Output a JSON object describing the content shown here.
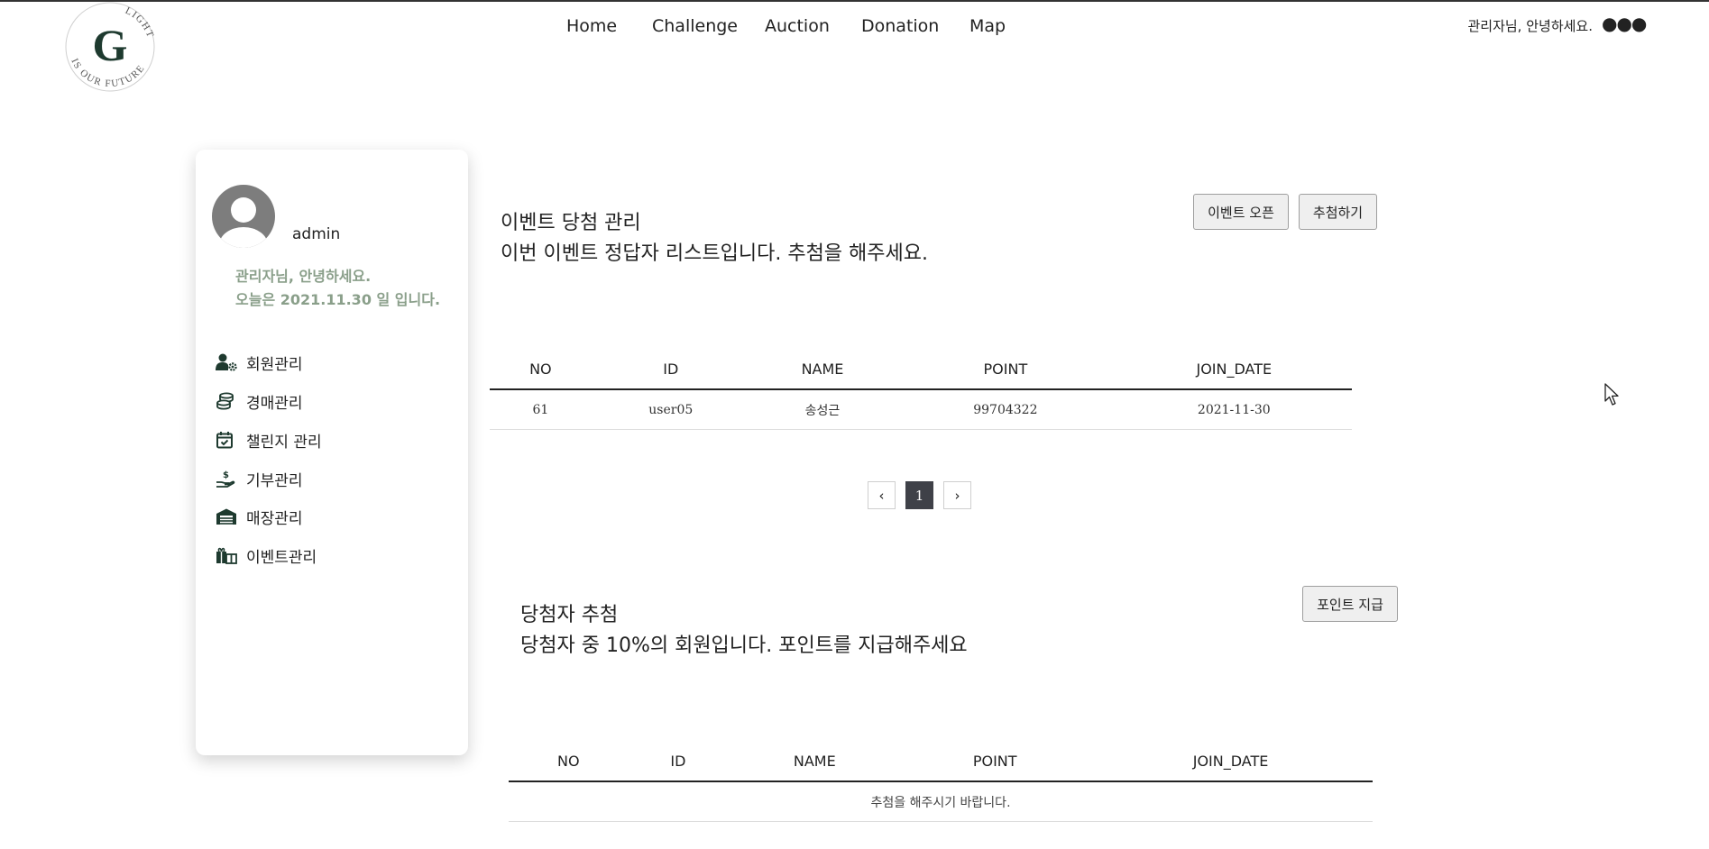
{
  "logo": {
    "letter": "G",
    "ring_text_top": "LIGHT",
    "ring_text_bottom": "IS OUR FUTURE"
  },
  "nav": {
    "home": "Home",
    "challenge": "Challenge",
    "auction": "Auction",
    "donation": "Donation",
    "map": "Map"
  },
  "header": {
    "greeting": "관리자님, 안녕하세요.",
    "more_icon": "more-horizontal-icon"
  },
  "sidebar": {
    "username": "admin",
    "welcome_line1": "관리자님, 안녕하세요.",
    "welcome_line2": "오늘은 2021.11.30 일 입니다.",
    "menu": [
      {
        "label": "회원관리",
        "icon": "user-gear-icon"
      },
      {
        "label": "경매관리",
        "icon": "coins-icon"
      },
      {
        "label": "챌린지 관리",
        "icon": "calendar-check-icon"
      },
      {
        "label": "기부관리",
        "icon": "hand-holding-dollar-icon"
      },
      {
        "label": "매장관리",
        "icon": "warehouse-icon"
      },
      {
        "label": "이벤트관리",
        "icon": "gifts-icon"
      }
    ]
  },
  "event_section": {
    "title": "이벤트 당첨 관리",
    "subtitle": "이번 이벤트 정답자 리스트입니다. 추첨을 해주세요.",
    "open_button": "이벤트 오픈",
    "draw_button": "추첨하기",
    "columns": [
      "NO",
      "ID",
      "NAME",
      "POINT",
      "JOIN_DATE"
    ],
    "rows": [
      {
        "no": "61",
        "id": "user05",
        "name": "송성근",
        "point": "99704322",
        "join_date": "2021-11-30"
      }
    ],
    "pagination": {
      "prev": "‹",
      "current": "1",
      "next": "›"
    }
  },
  "winner_section": {
    "title": "당첨자 추첨",
    "subtitle": "당첨자 중 10%의 회원입니다. 포인트를 지급해주세요",
    "pay_button": "포인트 지급",
    "columns": [
      "NO",
      "ID",
      "NAME",
      "POINT",
      "JOIN_DATE"
    ],
    "empty_message": "추첨을 해주시기 바랍니다."
  },
  "colors": {
    "accent_dark": "#1e3a2f",
    "welcome_text": "#8a9f8a",
    "page_active": "#3f4148"
  }
}
